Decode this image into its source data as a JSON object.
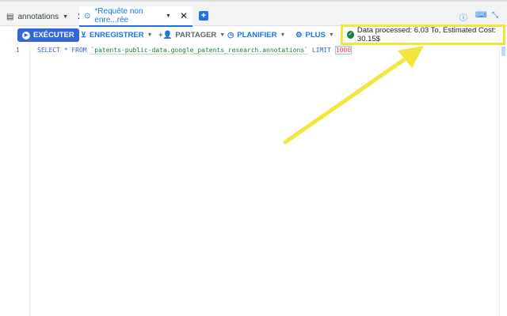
{
  "tabs": [
    {
      "label": "annotations",
      "icon": "table-icon"
    },
    {
      "label": "*Requête non enre...rée",
      "icon": "query-icon"
    }
  ],
  "toolbar": {
    "run": "EXÉCUTER",
    "save": "ENREGISTRER",
    "share": "PARTAGER",
    "schedule": "PLANIFIER",
    "more": "PLUS"
  },
  "status": {
    "text": "Data processed: 6.03 To, Estimated Cost: 30.15$",
    "icon": "check-circle-icon"
  },
  "editor": {
    "line_number": "1",
    "kw1": "SELECT",
    "star": " * ",
    "kw2": "FROM",
    "table": "`patents-public-data.google_patents_research.annotations`",
    "kw3": "LIMIT",
    "limit": "1000"
  },
  "colors": {
    "accent": "#1a73e8",
    "highlight": "#f0e63c"
  }
}
